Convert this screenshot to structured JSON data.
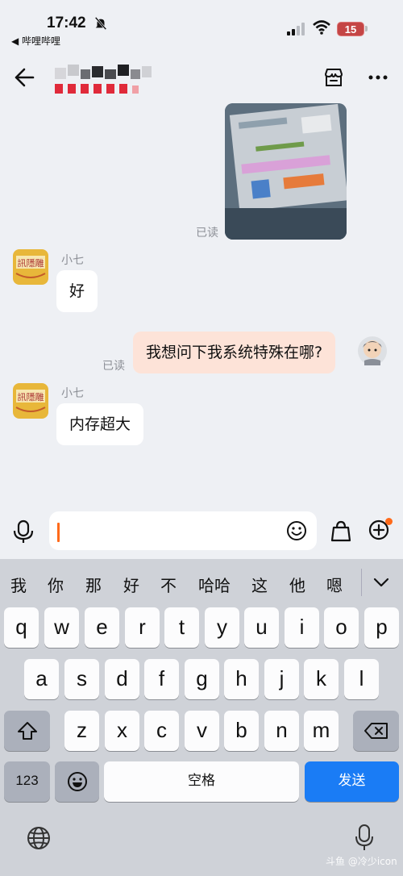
{
  "status": {
    "time": "17:42",
    "back_app": "◀ 哔哩哔哩",
    "battery": "15"
  },
  "chat": {
    "messages": [
      {
        "type": "image",
        "read_status": "已读"
      },
      {
        "type": "incoming",
        "sender": "小七",
        "text": "好"
      },
      {
        "type": "outgoing",
        "text": "我想问下我系统特殊在哪?",
        "read_status": "已读"
      },
      {
        "type": "incoming",
        "sender": "小七",
        "text": "内存超大"
      }
    ]
  },
  "keyboard": {
    "candidates": [
      "我",
      "你",
      "那",
      "好",
      "不",
      "哈哈",
      "这",
      "他",
      "嗯"
    ],
    "row1": [
      "q",
      "w",
      "e",
      "r",
      "t",
      "y",
      "u",
      "i",
      "o",
      "p"
    ],
    "row2": [
      "a",
      "s",
      "d",
      "f",
      "g",
      "h",
      "j",
      "k",
      "l"
    ],
    "row3": [
      "z",
      "x",
      "c",
      "v",
      "b",
      "n",
      "m"
    ],
    "num_label": "123",
    "space_label": "空格",
    "send_label": "发送"
  },
  "watermark": "斗鱼 @冷少icon",
  "colors": {
    "accent": "#ff6a1a",
    "send": "#1a7cf5",
    "self_bubble": "#fde3d8"
  }
}
